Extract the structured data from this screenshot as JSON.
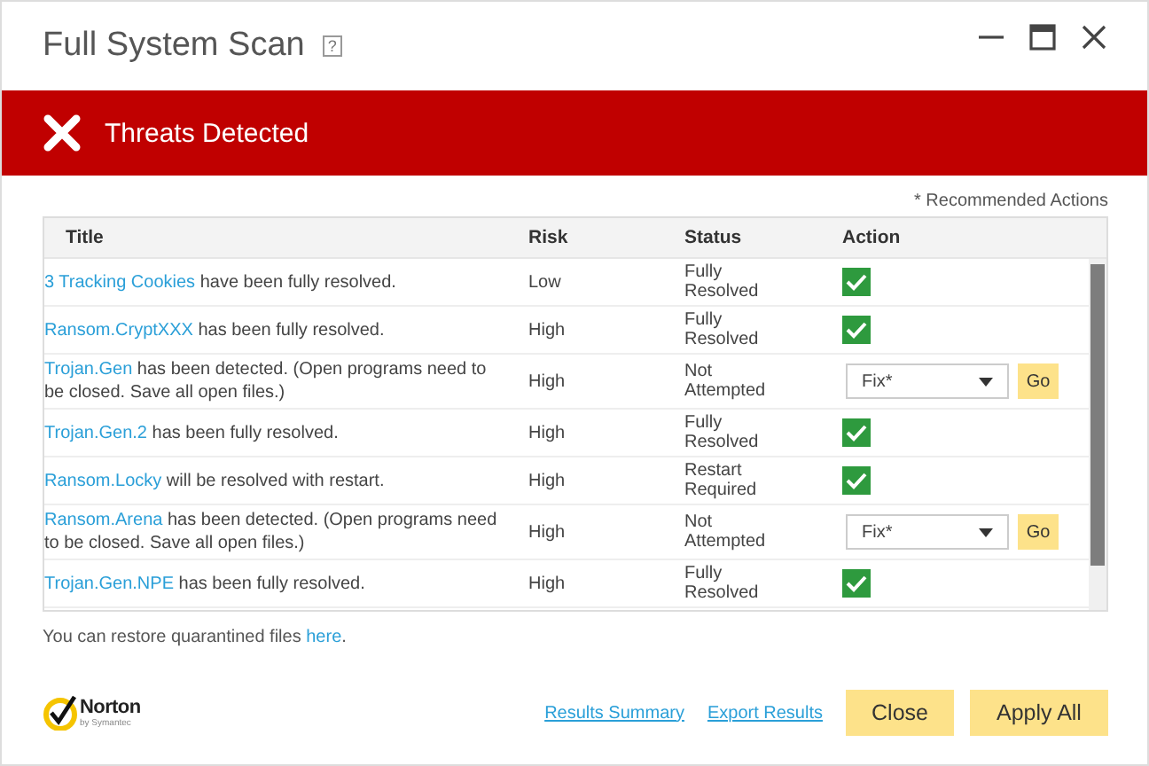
{
  "window": {
    "title": "Full System Scan",
    "help": "?"
  },
  "banner": {
    "text": "Threats Detected"
  },
  "note": "* Recommended Actions",
  "table": {
    "columns": [
      "Title",
      "Risk",
      "Status",
      "Action"
    ],
    "rows": [
      {
        "link": "3 Tracking Cookies",
        "text": "have been fully resolved.",
        "risk": "Low",
        "status": "Fully Resolved",
        "action": {
          "kind": "check",
          "checked": true
        }
      },
      {
        "link": "Ransom.CryptXXX",
        "text": "has been fully resolved.",
        "risk": "High",
        "status": "Fully Resolved",
        "action": {
          "kind": "check",
          "checked": true
        }
      },
      {
        "link": "Trojan.Gen",
        "text": "has been detected. (Open programs need to be closed. Save all open files.)",
        "risk": "High",
        "status": "Not Attempted",
        "action": {
          "kind": "select",
          "value": "Fix*",
          "button": "Go"
        }
      },
      {
        "link": "Trojan.Gen.2",
        "text": "has been fully resolved.",
        "risk": "High",
        "status": "Fully Resolved",
        "action": {
          "kind": "check",
          "checked": true
        }
      },
      {
        "link": "Ransom.Locky",
        "text": "will be resolved with restart.",
        "risk": "High",
        "status": "Restart Required",
        "action": {
          "kind": "check",
          "checked": true
        }
      },
      {
        "link": "Ransom.Arena",
        "text": "has been detected. (Open programs need to be closed. Save all open files.)",
        "risk": "High",
        "status": "Not Attempted",
        "action": {
          "kind": "select",
          "value": "Fix*",
          "button": "Go"
        }
      },
      {
        "link": "Trojan.Gen.NPE",
        "text": "has been fully resolved.",
        "risk": "High",
        "status": "Fully Resolved",
        "action": {
          "kind": "check",
          "checked": true
        }
      }
    ]
  },
  "restore": {
    "text": "You can restore quarantined files",
    "link": "here",
    "end": "."
  },
  "logo": {
    "name": "Norton",
    "sub": "by Symantec"
  },
  "links": [
    "Results Summary",
    "Export Results"
  ],
  "buttons": [
    "Close",
    "Apply All"
  ]
}
